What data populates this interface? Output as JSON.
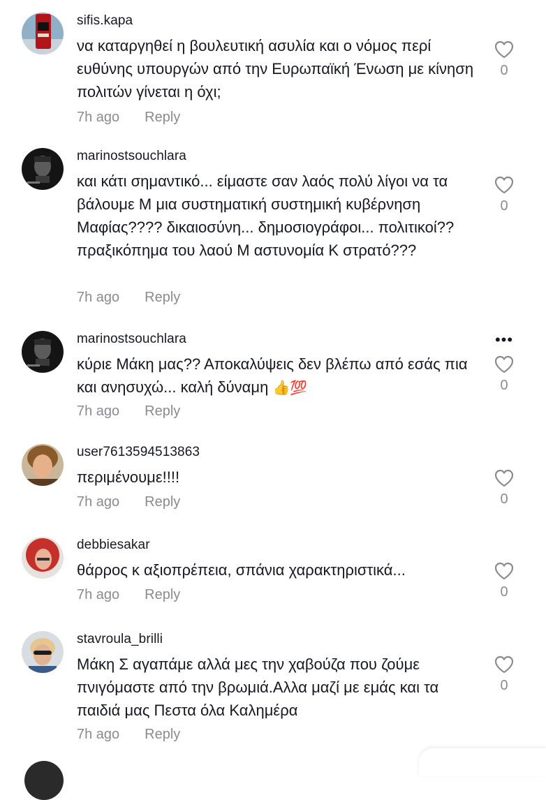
{
  "comments": [
    {
      "username": "sifis.kapa",
      "text": "να καταργηθεί η βουλευτική ασυλία και ο νόμος περί ευθύνης υπουργών από την Ευρωπαϊκή Ένωση με κίνηση πολιτών γίνεται η όχι;",
      "time": "7h ago",
      "reply": "Reply",
      "likes": "0"
    },
    {
      "username": "marinostsouchlara",
      "text": "και κάτι σημαντικό... είμαστε σαν λαός πολύ λίγοι να τα βάλουμε Μ μια συστηματική συστημική κυβέρνηση Μαφίας???? δικαιοσύνη... δημοσιογράφοι... πολιτικοί?? πραξικόπημα του λαού Μ αστυνομία Κ στρατό???",
      "time": "7h ago",
      "reply": "Reply",
      "likes": "0"
    },
    {
      "username": "marinostsouchlara",
      "text": "κύριε Μάκη μας?? Αποκαλύψεις δεν βλέπω από εσάς πια και ανησυχώ... καλή δύναμη",
      "emoji": "👍💯",
      "time": "7h ago",
      "reply": "Reply",
      "likes": "0",
      "more": "•••"
    },
    {
      "username": "user7613594513863",
      "text": "περιμένουμε!!!!",
      "time": "7h ago",
      "reply": "Reply",
      "likes": "0"
    },
    {
      "username": "debbiesakar",
      "text": "θάρρος κ αξιοπρέπεια, σπάνια χαρακτηριστικά...",
      "time": "7h ago",
      "reply": "Reply",
      "likes": "0"
    },
    {
      "username": "stavroula_brilli",
      "text": "Μάκη Σ αγαπάμε αλλά μες την χαβούζα που ζούμε πνιγόμαστε από την βρωμιά.Αλλα μαζί με εμάς και τα παιδιά μας Πεστα όλα Καλημέρα",
      "time": "7h ago",
      "reply": "Reply",
      "likes": "0"
    }
  ],
  "colors": {
    "text": "#161823",
    "muted": "#8a8b91",
    "background": "#ffffff"
  },
  "icons": {
    "like": "heart-outline-icon",
    "more": "more-horizontal-icon"
  }
}
